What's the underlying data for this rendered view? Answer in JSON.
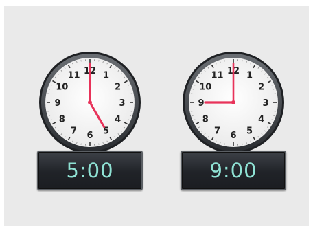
{
  "clocks": [
    {
      "hour": 5,
      "minute": 0,
      "time_text": "5:00",
      "numbers": [
        "12",
        "1",
        "2",
        "3",
        "4",
        "5",
        "6",
        "7",
        "8",
        "9",
        "10",
        "11"
      ]
    },
    {
      "hour": 9,
      "minute": 0,
      "time_text": "9:00",
      "numbers": [
        "12",
        "1",
        "2",
        "3",
        "4",
        "5",
        "6",
        "7",
        "8",
        "9",
        "10",
        "11"
      ]
    }
  ],
  "colors": {
    "panel": "#eaeaea",
    "hand": "#e8335a",
    "display_text": "#8fe2d4",
    "display_bg": "#202328"
  }
}
